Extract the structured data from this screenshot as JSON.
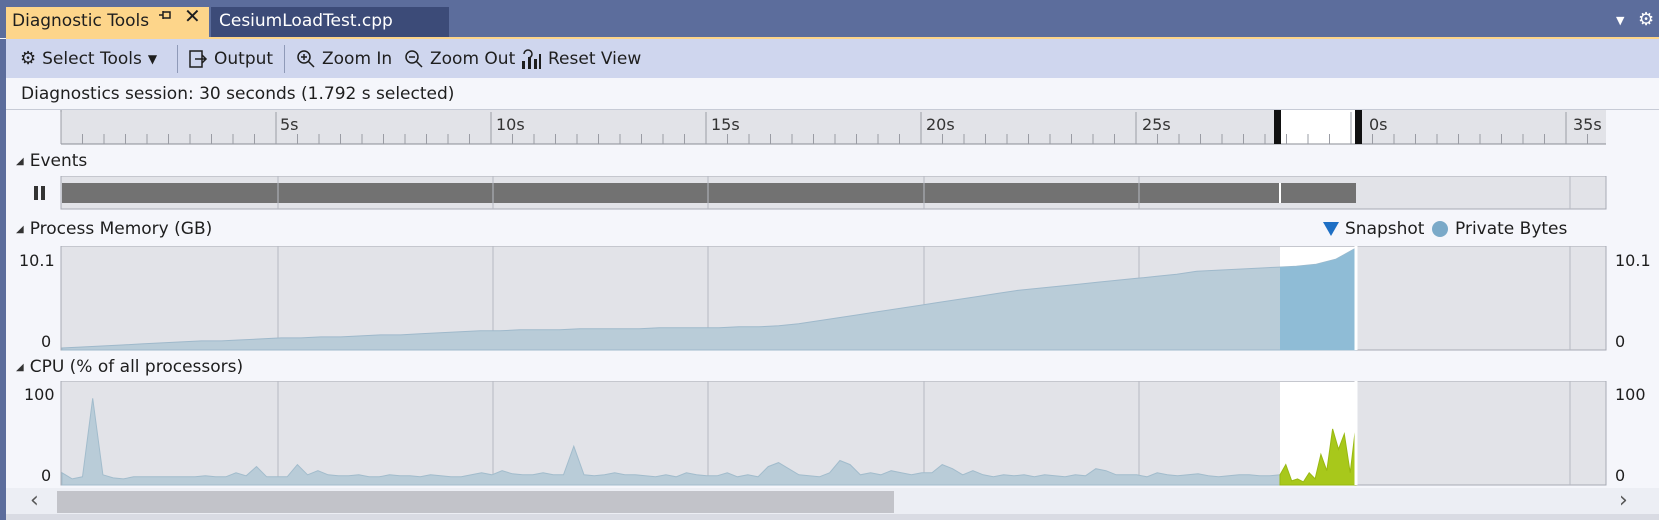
{
  "tabs": {
    "active_label": "Diagnostic Tools",
    "inactive_label": "CesiumLoadTest.cpp"
  },
  "toolbar": {
    "select_tools_label": "Select Tools",
    "output_label": "Output",
    "zoom_in_label": "Zoom In",
    "zoom_out_label": "Zoom Out",
    "reset_view_label": "Reset View"
  },
  "session": {
    "text": "Diagnostics session: 30 seconds (1.792 s selected)"
  },
  "ruler": {
    "ticks": [
      "5s",
      "10s",
      "15s",
      "20s",
      "25s",
      "0s",
      "35s"
    ]
  },
  "events": {
    "title": "Events"
  },
  "memory": {
    "title": "Process Memory (GB)",
    "legend_snapshot": "Snapshot",
    "legend_private_bytes": "Private Bytes",
    "max_label": "10.1",
    "min_label": "0",
    "max_value": 10.1,
    "samples": [
      0.2,
      0.3,
      0.4,
      0.5,
      0.6,
      0.7,
      0.8,
      0.9,
      0.9,
      1.0,
      1.1,
      1.2,
      1.2,
      1.3,
      1.3,
      1.4,
      1.5,
      1.5,
      1.6,
      1.7,
      1.8,
      1.9,
      1.9,
      2.0,
      2.0,
      2.0,
      2.1,
      2.1,
      2.1,
      2.1,
      2.2,
      2.2,
      2.2,
      2.2,
      2.3,
      2.3,
      2.4,
      2.6,
      2.9,
      3.2,
      3.5,
      3.8,
      4.1,
      4.4,
      4.7,
      5.0,
      5.3,
      5.6,
      5.9,
      6.1,
      6.3,
      6.5,
      6.7,
      6.9,
      7.1,
      7.3,
      7.5,
      7.8,
      7.9,
      8.0,
      8.1,
      8.2,
      8.3,
      8.5,
      9.0,
      10.1
    ]
  },
  "cpu": {
    "title": "CPU (% of all processors)",
    "max_label": "100",
    "min_label": "0",
    "samples": [
      12,
      6,
      8,
      85,
      10,
      7,
      6,
      8,
      8,
      8,
      8,
      8,
      8,
      8,
      9,
      8,
      8,
      12,
      9,
      18,
      8,
      8,
      8,
      20,
      10,
      14,
      10,
      9,
      9,
      10,
      8,
      8,
      10,
      9,
      9,
      8,
      10,
      9,
      8,
      8,
      10,
      12,
      10,
      14,
      11,
      10,
      10,
      12,
      10,
      10,
      38,
      10,
      9,
      10,
      12,
      10,
      10,
      9,
      8,
      10,
      8,
      12,
      10,
      9,
      9,
      12,
      8,
      10,
      8,
      18,
      22,
      16,
      10,
      9,
      8,
      12,
      24,
      20,
      10,
      12,
      10,
      14,
      12,
      10,
      12,
      12,
      20,
      16,
      10,
      14,
      10,
      8,
      10,
      9,
      10,
      8,
      10,
      9,
      8,
      10,
      9,
      16,
      14,
      10,
      10,
      10,
      8,
      12,
      10,
      9,
      10,
      11,
      9,
      8,
      9,
      10,
      10,
      9,
      9,
      10
    ],
    "selected_samples": [
      10,
      20,
      4,
      6,
      3,
      12,
      6,
      30,
      14,
      55,
      35,
      50,
      12,
      60
    ]
  }
}
